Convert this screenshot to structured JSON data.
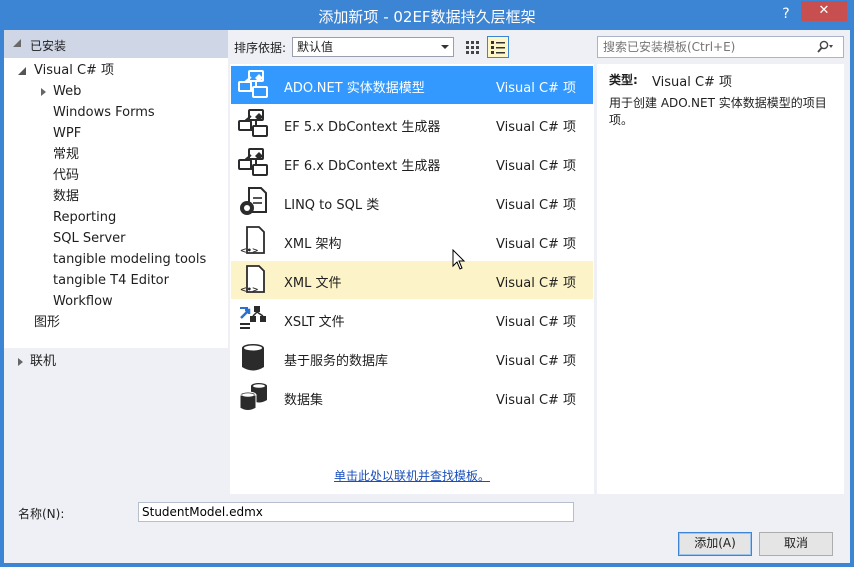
{
  "window": {
    "title": "添加新项 - 02EF数据持久层框架",
    "help_label": "?",
    "close_label": "✕"
  },
  "left": {
    "installed_label": "已安装",
    "tree": [
      {
        "label": "Visual C# 项",
        "level": 0,
        "expander": "open"
      },
      {
        "label": "Web",
        "level": 1,
        "expander": "closed"
      },
      {
        "label": "Windows Forms",
        "level": 1,
        "expander": "none"
      },
      {
        "label": "WPF",
        "level": 1,
        "expander": "none"
      },
      {
        "label": "常规",
        "level": 1,
        "expander": "none"
      },
      {
        "label": "代码",
        "level": 1,
        "expander": "none"
      },
      {
        "label": "数据",
        "level": 1,
        "expander": "none",
        "selected": true
      },
      {
        "label": "Reporting",
        "level": 1,
        "expander": "none"
      },
      {
        "label": "SQL Server",
        "level": 1,
        "expander": "none"
      },
      {
        "label": "tangible modeling tools",
        "level": 1,
        "expander": "none"
      },
      {
        "label": "tangible T4 Editor",
        "level": 1,
        "expander": "none"
      },
      {
        "label": "Workflow",
        "level": 1,
        "expander": "none"
      },
      {
        "label": "图形",
        "level": 0,
        "expander": "none"
      }
    ],
    "online_label": "联机"
  },
  "toolbar": {
    "sort_label": "排序依据:",
    "sort_value": "默认值"
  },
  "search": {
    "placeholder": "搜索已安装模板(Ctrl+E)"
  },
  "templates": [
    {
      "name": "ADO.NET 实体数据模型",
      "type": "Visual C# 项",
      "icon": "entity-model-icon",
      "state": "selected"
    },
    {
      "name": "EF 5.x DbContext 生成器",
      "type": "Visual C# 项",
      "icon": "dbcontext-generator-icon",
      "state": ""
    },
    {
      "name": "EF 6.x DbContext 生成器",
      "type": "Visual C# 项",
      "icon": "dbcontext-generator-icon",
      "state": ""
    },
    {
      "name": "LINQ to SQL 类",
      "type": "Visual C# 项",
      "icon": "linq-to-sql-icon",
      "state": ""
    },
    {
      "name": "XML 架构",
      "type": "Visual C# 项",
      "icon": "xml-schema-icon",
      "state": ""
    },
    {
      "name": "XML 文件",
      "type": "Visual C# 项",
      "icon": "xml-file-icon",
      "state": "hover"
    },
    {
      "name": "XSLT 文件",
      "type": "Visual C# 项",
      "icon": "xslt-file-icon",
      "state": ""
    },
    {
      "name": "基于服务的数据库",
      "type": "Visual C# 项",
      "icon": "database-icon",
      "state": ""
    },
    {
      "name": "数据集",
      "type": "Visual C# 项",
      "icon": "dataset-icon",
      "state": ""
    }
  ],
  "online_link": "单击此处以联机并查找模板。",
  "details": {
    "type_label": "类型:",
    "type_value": "Visual C# 项",
    "description": "用于创建 ADO.NET 实体数据模型的项目项。"
  },
  "bottom": {
    "name_label": "名称(N):",
    "name_value": "StudentModel.edmx",
    "add_label": "添加(A)",
    "cancel_label": "取消"
  },
  "colors": {
    "title_bar": "#3c84d4",
    "selected_row": "#3399ff",
    "hover_row": "#fcf3c8",
    "close_button": "#c74f50"
  }
}
